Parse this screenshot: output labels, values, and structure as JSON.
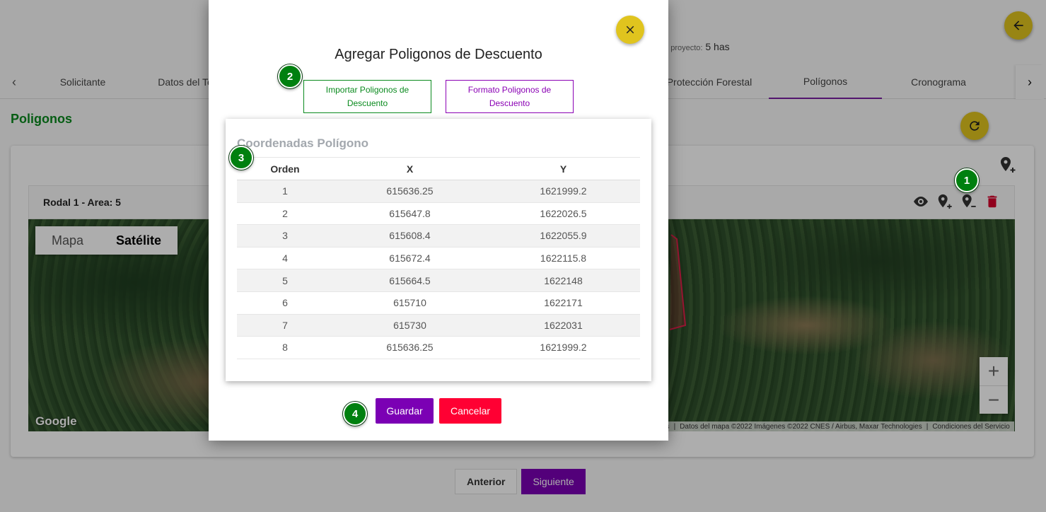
{
  "project": {
    "area_label": "l del proyecto:",
    "area_value": "5 has"
  },
  "tabs": [
    {
      "label": "Solicitante"
    },
    {
      "label": "Datos del Te"
    },
    {
      "label": "Protección Forestal"
    },
    {
      "label": "Polígonos"
    },
    {
      "label": "Cronograma"
    }
  ],
  "section": {
    "title": "Poligonos"
  },
  "rodal": {
    "title": "Rodal 1 - Area: 5"
  },
  "map": {
    "types": [
      "Mapa",
      "Satélite"
    ],
    "selected": "Satélite",
    "zoom_in": "+",
    "zoom_out": "−",
    "logo": "Google",
    "attribution": [
      "as",
      "Datos del mapa ©2022 Imágenes ©2022 CNES / Airbus, Maxar Technologies",
      "Condiciones del Servicio"
    ]
  },
  "navigation": {
    "prev": "Anterior",
    "next": "Siguiente"
  },
  "badges": [
    "1",
    "2",
    "3",
    "4"
  ],
  "modal": {
    "title": "Agregar Poligonos de Descuento",
    "import_button": "Importar Poligonos de Descuento",
    "format_button": "Formato Poligonos de Descuento",
    "coords_title": "Coordenadas Polígono",
    "columns": [
      "Orden",
      "X",
      "Y"
    ],
    "rows": [
      [
        "1",
        "615636.25",
        "1621999.2"
      ],
      [
        "2",
        "615647.8",
        "1622026.5"
      ],
      [
        "3",
        "615608.4",
        "1622055.9"
      ],
      [
        "4",
        "615672.4",
        "1622115.8"
      ],
      [
        "5",
        "615664.5",
        "1622148"
      ],
      [
        "6",
        "615710",
        "1622171"
      ],
      [
        "7",
        "615730",
        "1622031"
      ],
      [
        "8",
        "615636.25",
        "1621999.2"
      ]
    ],
    "save": "Guardar",
    "cancel": "Cancelar"
  },
  "colors": {
    "accent": "#7b00b4",
    "success": "#0a8a1e",
    "danger": "#ff0033",
    "fab": "#e0c41e"
  },
  "icons": [
    "arrow-left-icon",
    "chevron-left-icon",
    "chevron-right-icon",
    "refresh-icon",
    "map-pin-add-icon",
    "eye-icon",
    "map-pin-remove-icon",
    "trash-icon",
    "close-icon"
  ]
}
